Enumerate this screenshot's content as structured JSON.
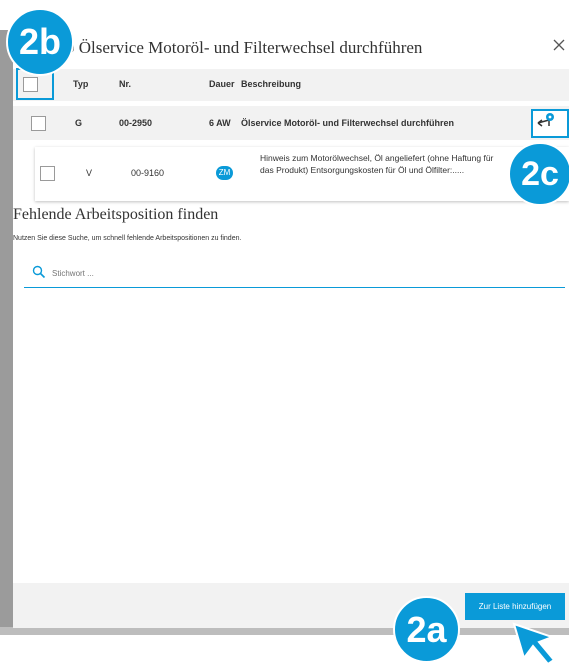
{
  "dialog": {
    "title": "0 Ölservice Motoröl- und Filterwechsel durchführen",
    "close_icon": "close-icon"
  },
  "table": {
    "headers": {
      "type": "Typ",
      "number": "Nr.",
      "duration": "Dauer",
      "description": "Beschreibung"
    },
    "rows": [
      {
        "type": "G",
        "number": "00-2950",
        "duration": "6 AW",
        "description": "Ölservice Motoröl- und Filterwechsel durchführen"
      },
      {
        "type": "V",
        "number": "00-9160",
        "badge": "ZM",
        "description": "Hinweis zum Motorölwechsel, Öl angeliefert (ohne Haftung für das Produkt) Entsorgungskosten für Öl und Ölfilter:....."
      }
    ]
  },
  "search_section": {
    "title": "Fehlende Arbeitsposition finden",
    "subtitle": "Nutzen Sie diese Suche, um schnell fehlende Arbeitspositionen zu finden.",
    "placeholder": "Stichwort ..."
  },
  "footer": {
    "add_button_label": "Zur Liste hinzufügen"
  },
  "annotations": {
    "marker_2a": "2a",
    "marker_2b": "2b",
    "marker_2c": "2c"
  },
  "colors": {
    "accent": "#0a9ad8",
    "header_bg": "#f2f2f2",
    "text": "#333333"
  }
}
